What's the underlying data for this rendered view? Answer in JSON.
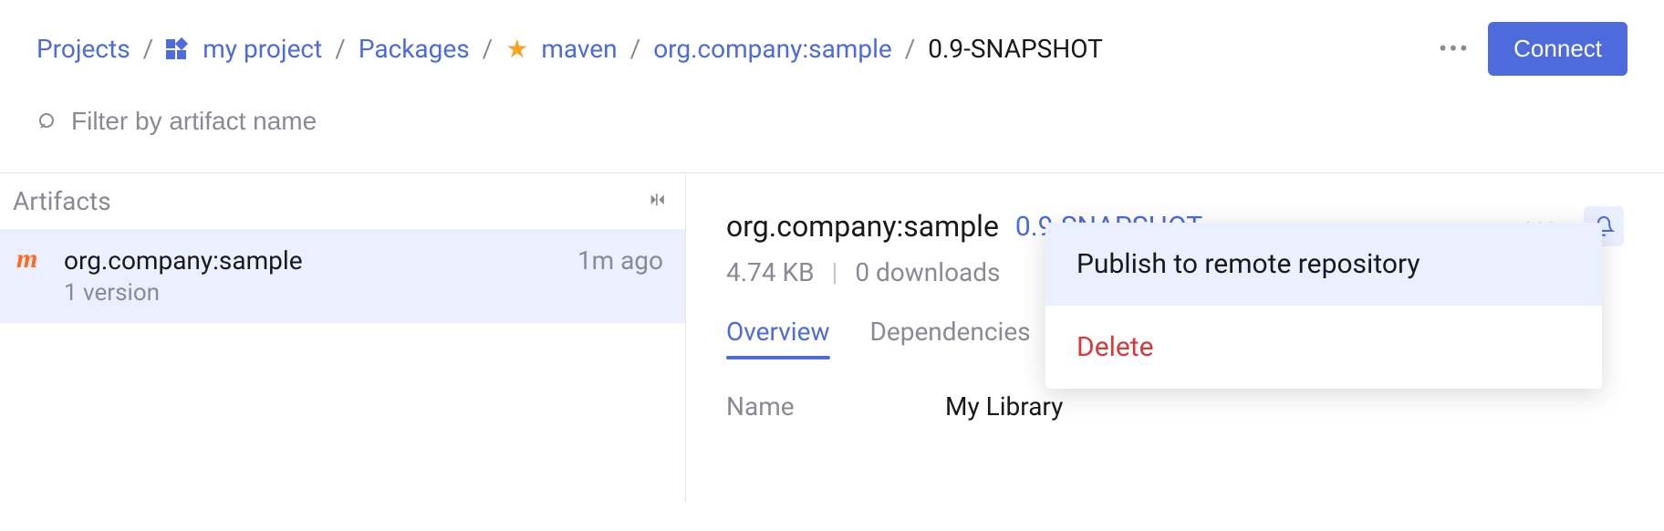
{
  "breadcrumb": {
    "projects_label": "Projects",
    "project_name": "my project",
    "packages_label": "Packages",
    "repo_name": "maven",
    "package_id": "org.company:sample",
    "current_version": "0.9-SNAPSHOT"
  },
  "header": {
    "connect_label": "Connect"
  },
  "filter": {
    "placeholder": "Filter by artifact name"
  },
  "left": {
    "title": "Artifacts",
    "items": [
      {
        "name": "org.company:sample",
        "versions_text": "1 version",
        "time_ago": "1m ago",
        "type_icon": "maven"
      }
    ]
  },
  "right": {
    "pkg_name": "org.company:sample",
    "version": "0.9-SNAPSHOT",
    "size": "4.74 KB",
    "downloads": "0 downloads",
    "tabs": [
      "Overview",
      "Dependencies"
    ],
    "details": {
      "name_label": "Name",
      "name_value": "My Library"
    }
  },
  "menu": {
    "publish": "Publish to remote repository",
    "delete": "Delete"
  },
  "colors": {
    "accent": "#4d6bda",
    "danger": "#d73a3a",
    "muted": "#8a8a94",
    "star": "#f5a623"
  }
}
